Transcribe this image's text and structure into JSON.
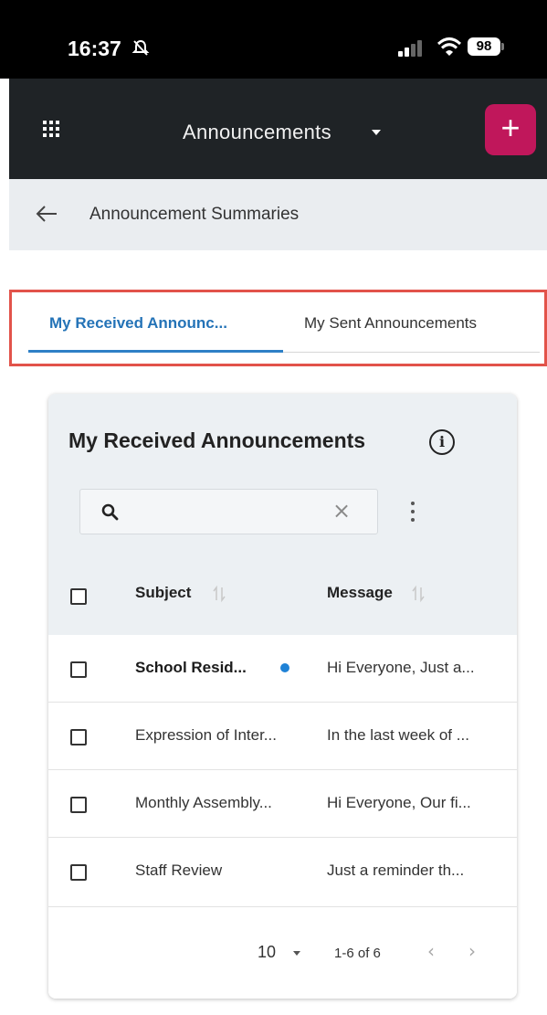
{
  "status_bar": {
    "time": "16:37",
    "battery": "98"
  },
  "app_bar": {
    "title": "Announcements",
    "add_label": "+"
  },
  "sub_header": {
    "title": "Announcement Summaries"
  },
  "tabs": [
    {
      "label": "My Received Announc...",
      "active": true
    },
    {
      "label": "My Sent Announcements",
      "active": false
    }
  ],
  "card": {
    "title": "My Received Announcements",
    "info_glyph": "i",
    "search": {
      "value": "",
      "placeholder": "",
      "clear_glyph": "×"
    },
    "columns": {
      "subject": "Subject",
      "message": "Message"
    },
    "rows": [
      {
        "subject": "School Resid...",
        "message": "Hi Everyone, Just a...",
        "unread": true
      },
      {
        "subject": "Expression of Inter...",
        "message": "In the last week of ...",
        "unread": false
      },
      {
        "subject": "Monthly Assembly...",
        "message": "Hi Everyone, Our fi...",
        "unread": false
      },
      {
        "subject": "Staff Review",
        "message": "Just a reminder th...",
        "unread": false
      }
    ],
    "footer": {
      "page_size": "10",
      "range": "1-6 of 6",
      "prev_glyph": "‹",
      "next_glyph": "›"
    }
  },
  "colors": {
    "accent": "#2473b7",
    "add_button": "#c0175b",
    "app_bar": "#1f2326",
    "highlight_frame": "#e2534a",
    "unread_dot": "#1f82d6"
  }
}
